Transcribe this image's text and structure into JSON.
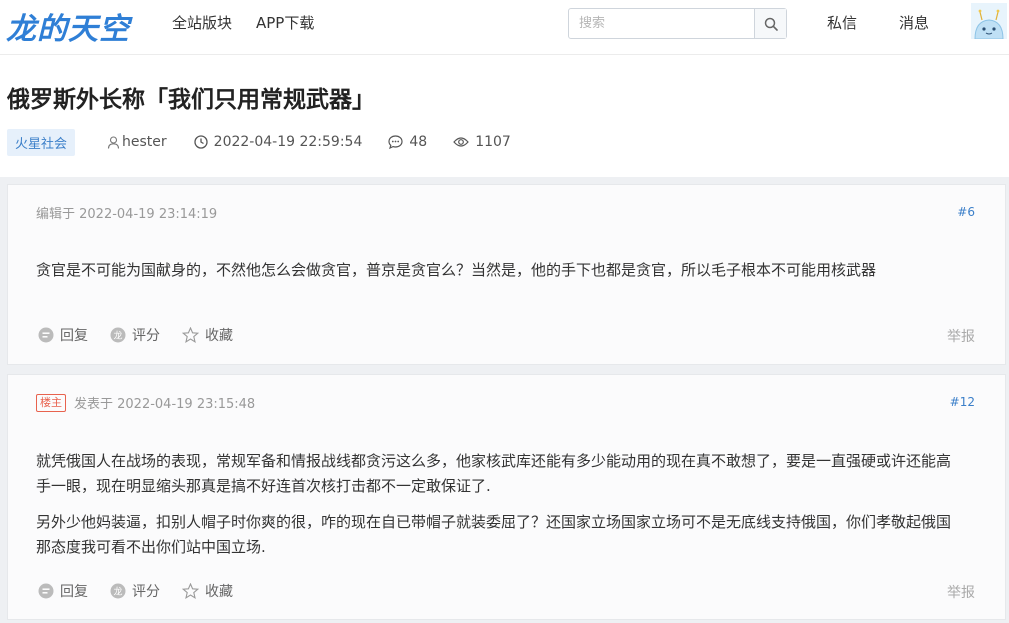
{
  "header": {
    "logo": "龙的天空",
    "nav": [
      "全站版块",
      "APP下载"
    ],
    "search_placeholder": "搜索",
    "messages_label": "私信",
    "notifications_label": "消息"
  },
  "thread": {
    "title": "俄罗斯外长称「我们只用常规武器」",
    "category": "火星社会",
    "author": "hester",
    "datetime": "2022-04-19 22:59:54",
    "comments": "48",
    "views": "1107"
  },
  "posts": [
    {
      "meta": "编辑于 2022-04-19 23:14:19",
      "floor": "#6",
      "paragraphs": [
        "贪官是不可能为国献身的，不然他怎么会做贪官，普京是贪官么？当然是，他的手下也都是贪官，所以毛子根本不可能用核武器"
      ]
    },
    {
      "badge": "楼主",
      "meta": "发表于 2022-04-19 23:15:48",
      "floor": "#12",
      "paragraphs": [
        "就凭俄国人在战场的表现，常规军备和情报战线都贪污这么多，他家核武库还能有多少能动用的现在真不敢想了，要是一直强硬或许还能高手一眼，现在明显缩头那真是搞不好连首次核打击都不一定敢保证了.",
        "另外少他妈装逼，扣别人帽子时你爽的很，咋的现在自已带帽子就装委屈了？还国家立场国家立场可不是无底线支持俄国，你们孝敬起俄国那态度我可看不出你们站中国立场."
      ]
    }
  ],
  "actions": {
    "reply": "回复",
    "rate": "评分",
    "favorite": "收藏",
    "report": "举报"
  }
}
